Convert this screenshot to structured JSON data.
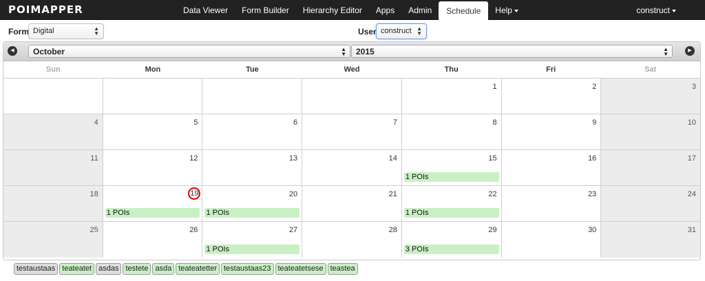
{
  "brand": {
    "logo_text": "POIMAPPER"
  },
  "nav": {
    "items": [
      {
        "label": "Data Viewer"
      },
      {
        "label": "Form Builder"
      },
      {
        "label": "Hierarchy Editor"
      },
      {
        "label": "Apps"
      },
      {
        "label": "Admin"
      },
      {
        "label": "Schedule"
      },
      {
        "label": "Help"
      }
    ],
    "active": "Schedule",
    "user": "construct"
  },
  "filters": {
    "form_label": "Form",
    "form_value": "Digital",
    "user_label": "User",
    "user_value": "construct"
  },
  "calendar": {
    "month": "October",
    "year": "2015",
    "days_of_week": [
      "Sun",
      "Mon",
      "Tue",
      "Wed",
      "Thu",
      "Fri",
      "Sat"
    ],
    "weeks": [
      [
        {
          "n": ""
        },
        {
          "n": ""
        },
        {
          "n": ""
        },
        {
          "n": ""
        },
        {
          "n": "1"
        },
        {
          "n": "2"
        },
        {
          "n": "3"
        }
      ],
      [
        {
          "n": "4"
        },
        {
          "n": "5"
        },
        {
          "n": "6"
        },
        {
          "n": "7"
        },
        {
          "n": "8"
        },
        {
          "n": "9"
        },
        {
          "n": "10"
        }
      ],
      [
        {
          "n": "11"
        },
        {
          "n": "12"
        },
        {
          "n": "13"
        },
        {
          "n": "14"
        },
        {
          "n": "15",
          "event": "1 POIs"
        },
        {
          "n": "16"
        },
        {
          "n": "17"
        }
      ],
      [
        {
          "n": "18"
        },
        {
          "n": "19",
          "today": true,
          "event": "1 POIs"
        },
        {
          "n": "20",
          "event": "1 POIs"
        },
        {
          "n": "21"
        },
        {
          "n": "22",
          "event": "1 POIs"
        },
        {
          "n": "23"
        },
        {
          "n": "24"
        }
      ],
      [
        {
          "n": "25"
        },
        {
          "n": "26"
        },
        {
          "n": "27",
          "event": "1 POIs"
        },
        {
          "n": "28"
        },
        {
          "n": "29",
          "event": "3 POIs"
        },
        {
          "n": "30"
        },
        {
          "n": "31"
        }
      ]
    ]
  },
  "tags": [
    {
      "label": "testaustaas",
      "color": "gray"
    },
    {
      "label": "teateatet",
      "color": "green"
    },
    {
      "label": "asdas",
      "color": "gray"
    },
    {
      "label": "testete",
      "color": "green"
    },
    {
      "label": "asda",
      "color": "green"
    },
    {
      "label": "teateatetter",
      "color": "green"
    },
    {
      "label": "testaustaas23",
      "color": "green"
    },
    {
      "label": "teateatetsese",
      "color": "green"
    },
    {
      "label": "teastea",
      "color": "green"
    }
  ],
  "colors": {
    "nav_bg": "#222222",
    "event_bg": "#c9f0c4",
    "today_ring": "#dd0000"
  }
}
